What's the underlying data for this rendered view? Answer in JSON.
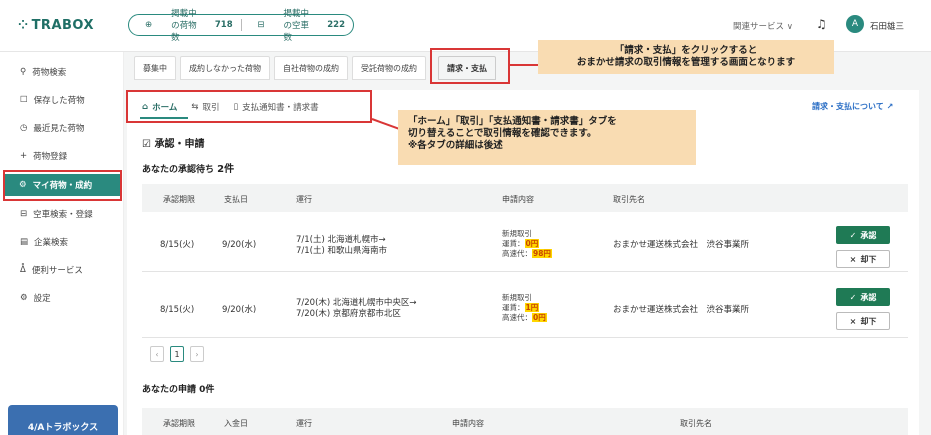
{
  "header": {
    "logo": "TRABOX",
    "pill": {
      "cargo_label": "掲載中の荷物数",
      "cargo_count": "718",
      "truck_label": "掲載中の空車数",
      "truck_count": "222"
    },
    "related_services": "関連サービス",
    "username": "石田雄三",
    "avatar_initial": "A"
  },
  "sidebar": {
    "items": [
      {
        "label": "荷物検索",
        "icon": "search-icon"
      },
      {
        "label": "保存した荷物",
        "icon": "bookmark-icon"
      },
      {
        "label": "最近見た荷物",
        "icon": "clock-icon"
      },
      {
        "label": "荷物登録",
        "icon": "plus-icon"
      },
      {
        "label": "マイ荷物・成約",
        "icon": "gear-icon"
      },
      {
        "label": "空車検索・登録",
        "icon": "truck-icon"
      },
      {
        "label": "企業検索",
        "icon": "building-icon"
      },
      {
        "label": "便利サービス",
        "icon": "person-icon"
      },
      {
        "label": "設定",
        "icon": "settings-icon"
      }
    ],
    "promo": "4/Aトラボックス"
  },
  "tabs": [
    "募集中",
    "成約しなかった荷物",
    "自社荷物の成約",
    "受託荷物の成約",
    "請求・支払"
  ],
  "callout1": {
    "line1": "「請求・支払」をクリックすると",
    "line2": "おまかせ請求の取引情報を管理する画面となります"
  },
  "subtabs": [
    "ホーム",
    "取引",
    "支払通知書・請求書"
  ],
  "callout2": {
    "line1": "「ホーム」「取引」「支払通知書・請求書」タブを",
    "line2": "切り替えることで取引情報を確認できます。",
    "line3": "※各タブの詳細は後述"
  },
  "help_link": "請求・支払について",
  "section_title": "承認・申請",
  "waiting": {
    "label": "あなたの承認待ち",
    "count": "2件"
  },
  "table": {
    "headers": [
      "承認期限",
      "支払日",
      "運行",
      "申請内容",
      "取引先名"
    ],
    "rows": [
      {
        "deadline": "8/15(火)",
        "pay_date": "9/20(水)",
        "route1": "7/1(土) 北海道札幌市→",
        "route2": "7/1(土) 和歌山県海南市",
        "type": "新規取引",
        "fare_label": "運賃：",
        "fare": "0円",
        "toll_label": "高速代：",
        "toll": "98円",
        "partner": "おまかせ運送株式会社　渋谷事業所"
      },
      {
        "deadline": "8/15(火)",
        "pay_date": "9/20(水)",
        "route1": "7/20(木) 北海道札幌市中央区→",
        "route2": "7/20(木) 京都府京都市北区",
        "type": "新規取引",
        "fare_label": "運賃：",
        "fare": "1円",
        "toll_label": "高速代：",
        "toll": "0円",
        "partner": "おまかせ運送株式会社　渋谷事業所"
      }
    ],
    "approve": "承認",
    "reject": "却下"
  },
  "pager": {
    "prev": "‹",
    "current": "1",
    "next": "›"
  },
  "applications": {
    "label": "あなたの申請",
    "count": "0件"
  },
  "apps_headers": [
    "承認期限",
    "入金日",
    "運行",
    "申請内容",
    "取引先名"
  ]
}
